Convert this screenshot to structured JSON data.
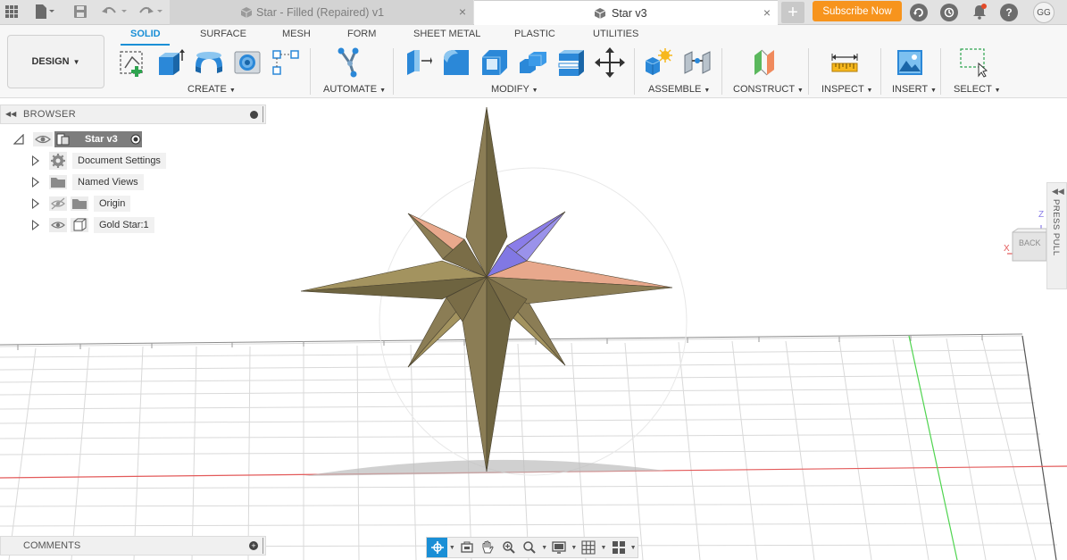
{
  "titlebar": {
    "tabs": [
      {
        "label": "Star - Filled (Repaired) v1",
        "active": false
      },
      {
        "label": "Star v3",
        "active": true
      }
    ],
    "subscribe_label": "Subscribe Now",
    "user_initials": "GG",
    "icons": [
      "apps-grid-icon",
      "file-icon",
      "save-icon",
      "undo-icon",
      "redo-icon",
      "new-tab-icon",
      "job-status-icon",
      "history-icon",
      "notifications-icon",
      "help-icon"
    ]
  },
  "ribbon": {
    "workspace_label": "DESIGN",
    "tabs": [
      "SOLID",
      "SURFACE",
      "MESH",
      "FORM",
      "SHEET METAL",
      "PLASTIC",
      "UTILITIES"
    ],
    "active_tab": "SOLID",
    "groups": [
      "CREATE",
      "AUTOMATE",
      "MODIFY",
      "ASSEMBLE",
      "CONSTRUCT",
      "INSPECT",
      "INSERT",
      "SELECT"
    ]
  },
  "browser": {
    "title": "BROWSER",
    "root": "Star v3",
    "items": [
      {
        "label": "Document Settings",
        "icon": "gear-icon"
      },
      {
        "label": "Named Views",
        "icon": "folder-icon"
      },
      {
        "label": "Origin",
        "icon": "folder-icon"
      },
      {
        "label": "Gold Star:1",
        "icon": "component-icon"
      }
    ]
  },
  "viewcube": {
    "face": "BACK",
    "axis_z": "Z",
    "axis_x": "X"
  },
  "press_pull": "PRESS PULL",
  "comments": {
    "title": "COMMENTS"
  },
  "colors": {
    "accent": "#1a8fd6",
    "subscribe": "#f7941d",
    "star_gold": "#8b7d55",
    "star_gold_dark": "#6e6440",
    "star_salmon": "#e8a88c",
    "star_purple": "#8a7de8"
  }
}
